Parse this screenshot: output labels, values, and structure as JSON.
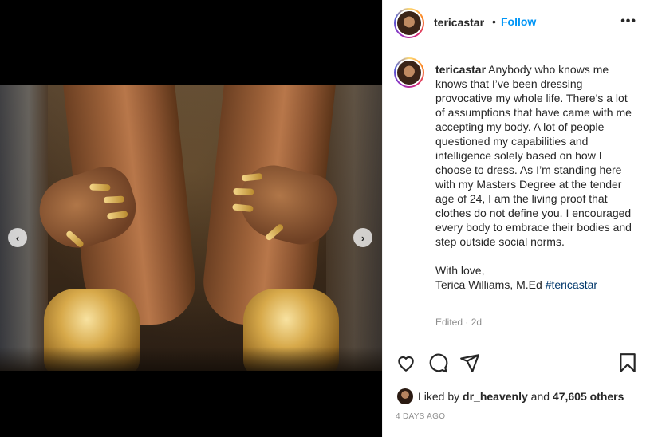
{
  "post": {
    "image_alt": "Close-up of legs with gold snake nail jewelry and gold heels",
    "nav": {
      "prev_icon": "chevron-left-icon",
      "next_icon": "chevron-right-icon",
      "prev_glyph": "‹",
      "next_glyph": "›"
    }
  },
  "header": {
    "username": "tericastar",
    "separator": "•",
    "follow_label": "Follow",
    "more_glyph": "•••"
  },
  "caption": {
    "username": "tericastar",
    "body": "Anybody who knows me knows that I’ve been dressing provocative my whole life. There’s a lot of assumptions that have came with me accepting my body. A lot of people questioned my capabilities and intelligence solely based on how I choose to dress. As I’m standing here with my Masters Degree at the tender age of 24, I am the living proof that clothes do not define you. I encouraged every body to embrace their bodies and step outside social norms.",
    "signoff": "With love,",
    "signature": "Terica Williams, M.Ed",
    "hashtag": "#tericastar",
    "meta": "Edited · 2d"
  },
  "actions": {
    "like_icon": "heart-icon",
    "comment_icon": "comment-icon",
    "share_icon": "share-icon",
    "save_icon": "bookmark-icon"
  },
  "likes": {
    "prefix": "Liked by",
    "user": "dr_heavenly",
    "joiner": "and",
    "others": "47,605 others"
  },
  "timestamp": "4 DAYS AGO",
  "colors": {
    "link": "#0095f6",
    "hashtag": "#00376b",
    "muted": "#8e8e8e",
    "text": "#262626"
  }
}
